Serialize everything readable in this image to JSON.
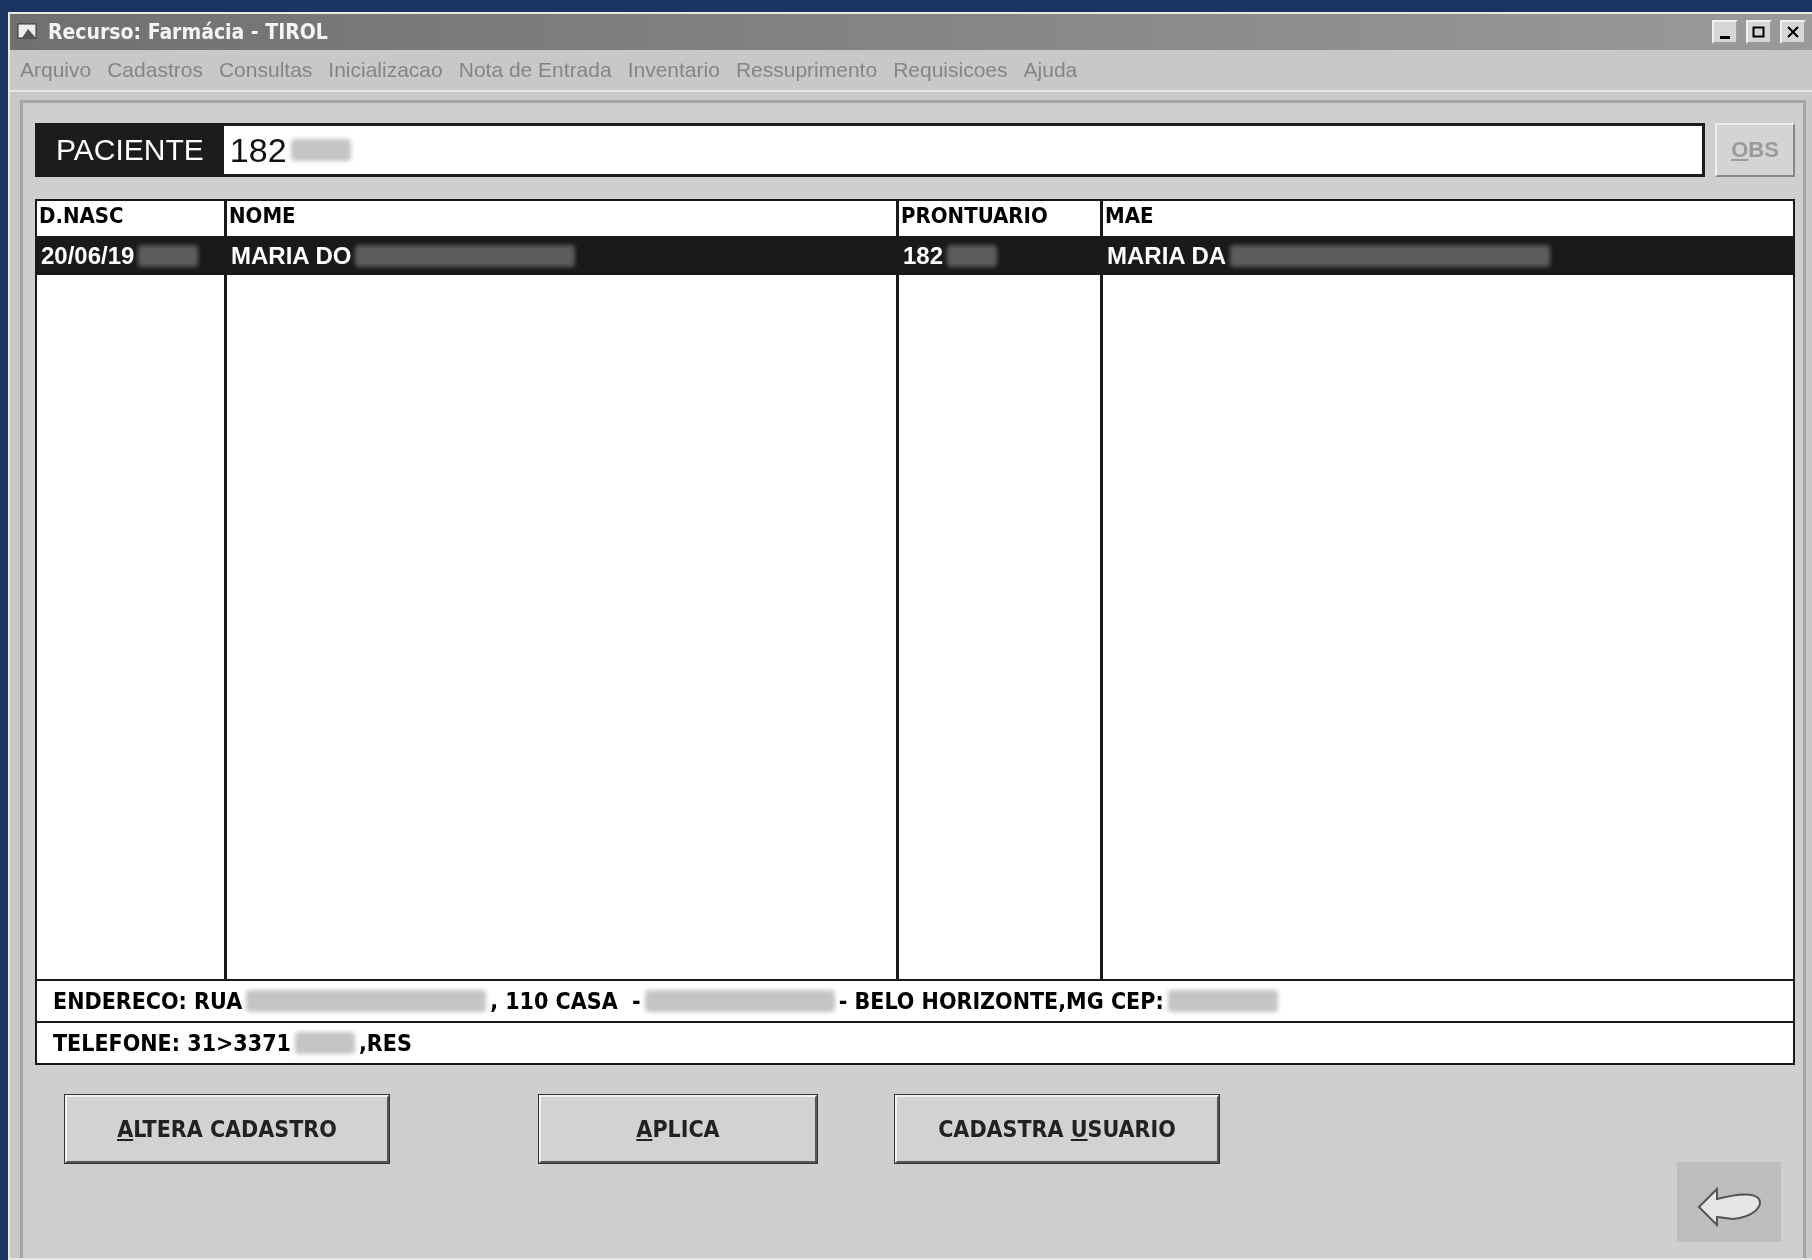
{
  "window": {
    "title": "Recurso: Farmácia - TIROL"
  },
  "menu": [
    "Arquivo",
    "Cadastros",
    "Consultas",
    "Inicializacao",
    "Nota de Entrada",
    "Inventario",
    "Ressuprimento",
    "Requisicoes",
    "Ajuda"
  ],
  "patient": {
    "label": "PACIENTE",
    "value": "182",
    "redacted": true,
    "obs_button": {
      "key": "O",
      "after": "BS",
      "disabled": true
    }
  },
  "table": {
    "columns": [
      "D.NASC",
      "NOME",
      "PRONTUARIO",
      "MAE"
    ],
    "rows": [
      {
        "selected": true,
        "cells": [
          {
            "text": "20/06/19",
            "redacted": true
          },
          {
            "text": "MARIA DO",
            "redacted": true
          },
          {
            "text": "182",
            "redacted": true
          },
          {
            "text": "MARIA DA",
            "redacted": true
          }
        ]
      }
    ]
  },
  "address": [
    {
      "text": "ENDERECO: RUA",
      "redacted": true
    },
    {
      "text": ", 110 CASA  -",
      "redacted": true
    },
    {
      "text": "- BELO HORIZONTE,MG CEP:",
      "redacted": true
    }
  ],
  "phone": [
    {
      "text": "TELEFONE: 31>3371",
      "redacted": true
    },
    {
      "text": ",RES",
      "redacted": false
    }
  ],
  "buttons": [
    {
      "key": "A",
      "after": "LTERA CADASTRO"
    },
    {
      "key": "A",
      "after": "PLICA"
    },
    {
      "before": "CADASTRA ",
      "key": "U",
      "after": "SUARIO"
    }
  ]
}
